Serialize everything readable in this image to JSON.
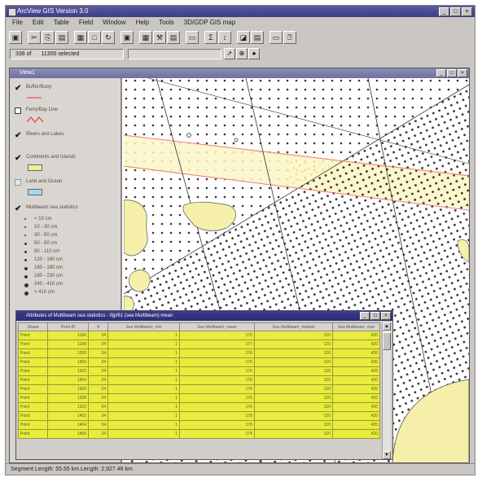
{
  "app": {
    "title": "ArcView GIS Version 3.0",
    "menu": [
      "File",
      "Edit",
      "Table",
      "Field",
      "Window",
      "Help",
      "Tools",
      "3D/GDP GIS map"
    ]
  },
  "toolbar": {
    "icons": [
      "save-icon",
      "cut-icon",
      "copy-icon",
      "paste-icon",
      "table-icon",
      "new-icon",
      "refresh-icon",
      "print-icon",
      "query-icon",
      "tools-icon",
      "promote-icon",
      "summarize-icon",
      "sum-icon",
      "sort-icon",
      "chart-icon",
      "field-icon",
      "window-icon",
      "help-icon"
    ],
    "glyphs": [
      "▣",
      "✂",
      "⎘",
      "▤",
      "▦",
      "□",
      "↻",
      "▣",
      "▦",
      "⚒",
      "▤",
      "▭",
      "Σ",
      "↕",
      "◪",
      "▤",
      "▭",
      "⍰"
    ]
  },
  "selection": {
    "count": "336 of",
    "selected": "11300 selected"
  },
  "map_tools": [
    "pointer-icon",
    "zoom-icon",
    "pan-icon"
  ],
  "view": {
    "title": "View1"
  },
  "legend": {
    "layers": [
      {
        "name": "Buffer/Buoy",
        "checked": true
      },
      {
        "name": "Ferry/Bay Line",
        "checked": false
      },
      {
        "name": "Rivers and Lakes",
        "checked": true
      },
      {
        "name": "Continents and Islands",
        "checked": true
      },
      {
        "name": "Land and Ocean",
        "checked": false
      },
      {
        "name": "Multibeam sea statistics",
        "checked": true
      }
    ],
    "classes": [
      "< 10 cm",
      "10 - 30 cm",
      "30 - 50 cm",
      "50 - 80 cm",
      "80 - 110 cm",
      "120 - 160 cm",
      "160 - 180 cm",
      "180 - 230 cm",
      "240 - 410 cm",
      "> 410 cm"
    ]
  },
  "table": {
    "title": "Attributes of Multibeam sea statistics - Ifgi/61 (sea Multibeam) mean",
    "columns": [
      "Shape",
      "Point ID",
      "N",
      "Sea Multibeam_min",
      "Sea Multibeam_mean",
      "Sea Multibeam_median",
      "Sea Multibeam_max"
    ],
    "rows": [
      [
        "Point",
        "1196",
        "24",
        "1",
        "176",
        "120",
        "420"
      ],
      [
        "Point",
        "1198",
        "24",
        "1",
        "177",
        "120",
        "420"
      ],
      [
        "Point",
        "1200",
        "24",
        "1",
        "176",
        "120",
        "420"
      ],
      [
        "Point",
        "1300",
        "24",
        "1",
        "176",
        "120",
        "420"
      ],
      [
        "Point",
        "1302",
        "24",
        "1",
        "176",
        "120",
        "420"
      ],
      [
        "Point",
        "1304",
        "24",
        "1",
        "176",
        "120",
        "420"
      ],
      [
        "Point",
        "1306",
        "24",
        "1",
        "176",
        "120",
        "420"
      ],
      [
        "Point",
        "1308",
        "24",
        "1",
        "176",
        "120",
        "420"
      ],
      [
        "Point",
        "1310",
        "24",
        "1",
        "176",
        "120",
        "420"
      ],
      [
        "Point",
        "1402",
        "24",
        "1",
        "178",
        "120",
        "420"
      ],
      [
        "Point",
        "1404",
        "24",
        "1",
        "176",
        "120",
        "420"
      ],
      [
        "Point",
        "1406",
        "24",
        "1",
        "176",
        "120",
        "420"
      ]
    ]
  },
  "status": {
    "text": "Segment Length: 55.55 km  Length: 2,927.46 km"
  },
  "colors": {
    "land": "#f5efaa",
    "table_rows": "#e8ec3c",
    "dots": "#2f2f2f"
  }
}
